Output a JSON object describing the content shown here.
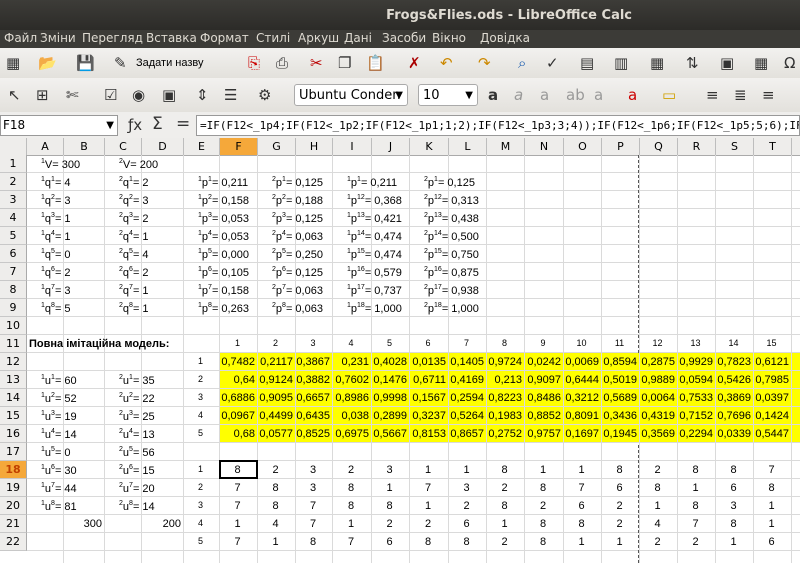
{
  "window": {
    "title": "Frogs&Flies.ods - LibreOffice Calc"
  },
  "menu": [
    "Файл",
    "Зміни",
    "Перегляд",
    "Вставка",
    "Формат",
    "Стилі",
    "Аркуш",
    "Дані",
    "Засоби",
    "Вікно",
    "Довідка"
  ],
  "toolbar": {
    "define_name": "Задати назву",
    "font_name": "Ubuntu Conden",
    "font_size": "10"
  },
  "formula_bar": {
    "name_box": "F18",
    "sigma": "Σ",
    "equals": "=",
    "formula": "=IF(F12<_1p4;IF(F12<_1p2;IF(F12<_1p1;1;2);IF(F12<_1p3;3;4));IF(F12<_1p6;IF(F12<_1p5;5;6);IF(F12<_1p7;7;8)))"
  },
  "columns": [
    "A",
    "B",
    "C",
    "D",
    "E",
    "F",
    "G",
    "H",
    "I",
    "J",
    "K",
    "L",
    "M",
    "N",
    "O",
    "P",
    "Q",
    "R",
    "S",
    "T"
  ],
  "rows": [
    "1",
    "2",
    "3",
    "4",
    "5",
    "6",
    "7",
    "8",
    "9",
    "10",
    "11",
    "12",
    "13",
    "14",
    "15",
    "16",
    "17",
    "18",
    "19",
    "20",
    "21",
    "22"
  ],
  "active_cell": {
    "col": "F",
    "row": "18"
  },
  "params": {
    "V": [
      {
        "pre": "1",
        "lbl": "V= 300"
      },
      {
        "pre": "2",
        "lbl": "V= 200"
      }
    ],
    "q1": [
      {
        "pre": "1",
        "lbl": "q",
        "sup": "1",
        "val": "= 4"
      },
      {
        "pre": "1",
        "lbl": "q",
        "sup": "2",
        "val": "= 3"
      },
      {
        "pre": "1",
        "lbl": "q",
        "sup": "3",
        "val": "= 1"
      },
      {
        "pre": "1",
        "lbl": "q",
        "sup": "4",
        "val": "= 1"
      },
      {
        "pre": "1",
        "lbl": "q",
        "sup": "5",
        "val": "= 0"
      },
      {
        "pre": "1",
        "lbl": "q",
        "sup": "6",
        "val": "= 2"
      },
      {
        "pre": "1",
        "lbl": "q",
        "sup": "7",
        "val": "= 3"
      },
      {
        "pre": "1",
        "lbl": "q",
        "sup": "8",
        "val": "= 5"
      }
    ],
    "q2": [
      {
        "pre": "2",
        "lbl": "q",
        "sup": "1",
        "val": "= 2"
      },
      {
        "pre": "2",
        "lbl": "q",
        "sup": "2",
        "val": "= 3"
      },
      {
        "pre": "2",
        "lbl": "q",
        "sup": "3",
        "val": "= 2"
      },
      {
        "pre": "2",
        "lbl": "q",
        "sup": "4",
        "val": "= 1"
      },
      {
        "pre": "2",
        "lbl": "q",
        "sup": "5",
        "val": "= 4"
      },
      {
        "pre": "2",
        "lbl": "q",
        "sup": "6",
        "val": "= 2"
      },
      {
        "pre": "2",
        "lbl": "q",
        "sup": "7",
        "val": "= 1"
      },
      {
        "pre": "2",
        "lbl": "q",
        "sup": "8",
        "val": "= 1"
      }
    ],
    "p1a": [
      {
        "pre": "1",
        "lbl": "p",
        "sup": "1",
        "val": "= 0,211"
      },
      {
        "pre": "1",
        "lbl": "p",
        "sup": "2",
        "val": "= 0,158"
      },
      {
        "pre": "1",
        "lbl": "p",
        "sup": "3",
        "val": "= 0,053"
      },
      {
        "pre": "1",
        "lbl": "p",
        "sup": "4",
        "val": "= 0,053"
      },
      {
        "pre": "1",
        "lbl": "p",
        "sup": "5",
        "val": "= 0,000"
      },
      {
        "pre": "1",
        "lbl": "p",
        "sup": "6",
        "val": "= 0,105"
      },
      {
        "pre": "1",
        "lbl": "p",
        "sup": "7",
        "val": "= 0,158"
      },
      {
        "pre": "1",
        "lbl": "p",
        "sup": "8",
        "val": "= 0,263"
      }
    ],
    "p2a": [
      {
        "pre": "2",
        "lbl": "p",
        "sup": "1",
        "val": "= 0,125"
      },
      {
        "pre": "2",
        "lbl": "p",
        "sup": "2",
        "val": "= 0,188"
      },
      {
        "pre": "2",
        "lbl": "p",
        "sup": "3",
        "val": "= 0,125"
      },
      {
        "pre": "2",
        "lbl": "p",
        "sup": "4",
        "val": "= 0,063"
      },
      {
        "pre": "2",
        "lbl": "p",
        "sup": "5",
        "val": "= 0,250"
      },
      {
        "pre": "2",
        "lbl": "p",
        "sup": "6",
        "val": "= 0,125"
      },
      {
        "pre": "2",
        "lbl": "p",
        "sup": "7",
        "val": "= 0,063"
      },
      {
        "pre": "2",
        "lbl": "p",
        "sup": "8",
        "val": "= 0,063"
      }
    ],
    "p1b": [
      {
        "pre": "1",
        "lbl": "p",
        "sup": "1",
        "val": "= 0,211"
      },
      {
        "pre": "1",
        "lbl": "p",
        "sup": "12",
        "val": "= 0,368"
      },
      {
        "pre": "1",
        "lbl": "p",
        "sup": "13",
        "val": "= 0,421"
      },
      {
        "pre": "1",
        "lbl": "p",
        "sup": "14",
        "val": "= 0,474"
      },
      {
        "pre": "1",
        "lbl": "p",
        "sup": "15",
        "val": "= 0,474"
      },
      {
        "pre": "1",
        "lbl": "p",
        "sup": "16",
        "val": "= 0,579"
      },
      {
        "pre": "1",
        "lbl": "p",
        "sup": "17",
        "val": "= 0,737"
      },
      {
        "pre": "1",
        "lbl": "p",
        "sup": "18",
        "val": "= 1,000"
      }
    ],
    "p2b": [
      {
        "pre": "2",
        "lbl": "p",
        "sup": "1",
        "val": "= 0,125"
      },
      {
        "pre": "2",
        "lbl": "p",
        "sup": "12",
        "val": "= 0,313"
      },
      {
        "pre": "2",
        "lbl": "p",
        "sup": "13",
        "val": "= 0,438"
      },
      {
        "pre": "2",
        "lbl": "p",
        "sup": "14",
        "val": "= 0,500"
      },
      {
        "pre": "2",
        "lbl": "p",
        "sup": "15",
        "val": "= 0,750"
      },
      {
        "pre": "2",
        "lbl": "p",
        "sup": "16",
        "val": "= 0,875"
      },
      {
        "pre": "2",
        "lbl": "p",
        "sup": "17",
        "val": "= 0,938"
      },
      {
        "pre": "2",
        "lbl": "p",
        "sup": "18",
        "val": "= 1,000"
      }
    ]
  },
  "model_label": "Повна імітаційна модель:",
  "step_numbers": [
    "1",
    "2",
    "3",
    "4",
    "5",
    "6",
    "7",
    "8",
    "9",
    "10",
    "11",
    "12",
    "13",
    "14",
    "15"
  ],
  "rand_row_ids": [
    "1",
    "2",
    "3",
    "4",
    "5"
  ],
  "rand": [
    [
      "0,7482",
      "0,2117",
      "0,3867",
      "0,231",
      "0,4028",
      "0,0135",
      "0,1405",
      "0,9724",
      "0,0242",
      "0,0069",
      "0,8594",
      "0,2875",
      "0,9929",
      "0,7823",
      "0,6121"
    ],
    [
      "0,64",
      "0,9124",
      "0,3882",
      "0,7602",
      "0,1476",
      "0,6711",
      "0,4169",
      "0,213",
      "0,9097",
      "0,6444",
      "0,5019",
      "0,9889",
      "0,0594",
      "0,5426",
      "0,7985"
    ],
    [
      "0,6886",
      "0,9095",
      "0,6657",
      "0,8986",
      "0,9998",
      "0,1567",
      "0,2594",
      "0,8223",
      "0,8486",
      "0,3212",
      "0,5689",
      "0,0064",
      "0,7533",
      "0,3869",
      "0,0397"
    ],
    [
      "0,0967",
      "0,4499",
      "0,6435",
      "0,038",
      "0,2899",
      "0,3237",
      "0,5264",
      "0,1983",
      "0,8852",
      "0,8091",
      "0,3436",
      "0,4319",
      "0,7152",
      "0,7696",
      "0,1424"
    ],
    [
      "0,68",
      "0,0577",
      "0,8525",
      "0,6975",
      "0,5667",
      "0,8153",
      "0,8657",
      "0,2752",
      "0,9757",
      "0,1697",
      "0,1945",
      "0,3569",
      "0,2294",
      "0,0339",
      "0,5447"
    ]
  ],
  "u1": [
    {
      "pre": "1",
      "sup": "1",
      "val": "= 60"
    },
    {
      "pre": "1",
      "sup": "2",
      "val": "= 52"
    },
    {
      "pre": "1",
      "sup": "3",
      "val": "= 19"
    },
    {
      "pre": "1",
      "sup": "4",
      "val": "= 14"
    },
    {
      "pre": "1",
      "sup": "5",
      "val": "= 0"
    },
    {
      "pre": "1",
      "sup": "6",
      "val": "= 30"
    },
    {
      "pre": "1",
      "sup": "7",
      "val": "= 44"
    },
    {
      "pre": "1",
      "sup": "8",
      "val": "= 81"
    }
  ],
  "u2": [
    {
      "pre": "2",
      "sup": "1",
      "val": "= 35"
    },
    {
      "pre": "2",
      "sup": "2",
      "val": "= 22"
    },
    {
      "pre": "2",
      "sup": "3",
      "val": "= 25"
    },
    {
      "pre": "2",
      "sup": "4",
      "val": "= 13"
    },
    {
      "pre": "2",
      "sup": "5",
      "val": "= 56"
    },
    {
      "pre": "2",
      "sup": "6",
      "val": "= 15"
    },
    {
      "pre": "2",
      "sup": "7",
      "val": "= 20"
    },
    {
      "pre": "2",
      "sup": "8",
      "val": "= 14"
    }
  ],
  "totals": [
    "300",
    "200"
  ],
  "sim_row_ids": [
    "1",
    "2",
    "3",
    "4",
    "5"
  ],
  "sim": [
    [
      "8",
      "2",
      "3",
      "2",
      "3",
      "1",
      "1",
      "8",
      "1",
      "1",
      "8",
      "2",
      "8",
      "8",
      "7"
    ],
    [
      "7",
      "8",
      "3",
      "8",
      "1",
      "7",
      "3",
      "2",
      "8",
      "7",
      "6",
      "8",
      "1",
      "6",
      "8"
    ],
    [
      "7",
      "8",
      "7",
      "8",
      "8",
      "1",
      "2",
      "8",
      "2",
      "6",
      "2",
      "1",
      "8",
      "3",
      "1"
    ],
    [
      "1",
      "4",
      "7",
      "1",
      "2",
      "2",
      "6",
      "1",
      "8",
      "8",
      "2",
      "4",
      "7",
      "8",
      "1"
    ],
    [
      "7",
      "1",
      "8",
      "7",
      "6",
      "8",
      "8",
      "2",
      "8",
      "1",
      "1",
      "2",
      "2",
      "1",
      "6"
    ]
  ]
}
